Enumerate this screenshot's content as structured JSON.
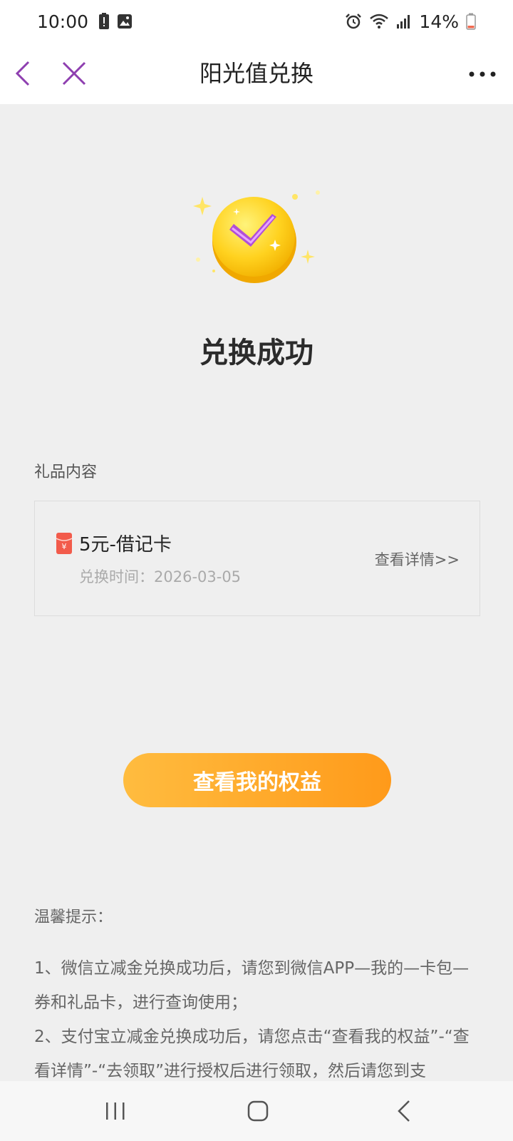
{
  "status_bar": {
    "time": "10:00",
    "battery_percent": "14%"
  },
  "nav": {
    "title": "阳光值兑换",
    "accent_color": "#8e3fb0"
  },
  "success": {
    "title": "兑换成功"
  },
  "gift": {
    "section_label": "礼品内容",
    "name": "5元-借记卡",
    "time_label": "兑换时间：",
    "time_value": "2026-03-05",
    "details_link": "查看详情>>"
  },
  "actions": {
    "view_benefits": "查看我的权益"
  },
  "tips": {
    "title": "温馨提示：",
    "line1": "1、微信立减金兑换成功后，请您到微信APP—我的—卡包—券和礼品卡，进行查询使用；",
    "line2": "2、支付宝立减金兑换成功后，请您点击“查看我的权益”-“查看详情”-“去领取”进行授权后进行领取，然后请您到支"
  },
  "colors": {
    "button_start": "#ffbc3f",
    "button_end": "#ff9a1a",
    "badge": "#f5c518",
    "check": "#b14fd8"
  }
}
